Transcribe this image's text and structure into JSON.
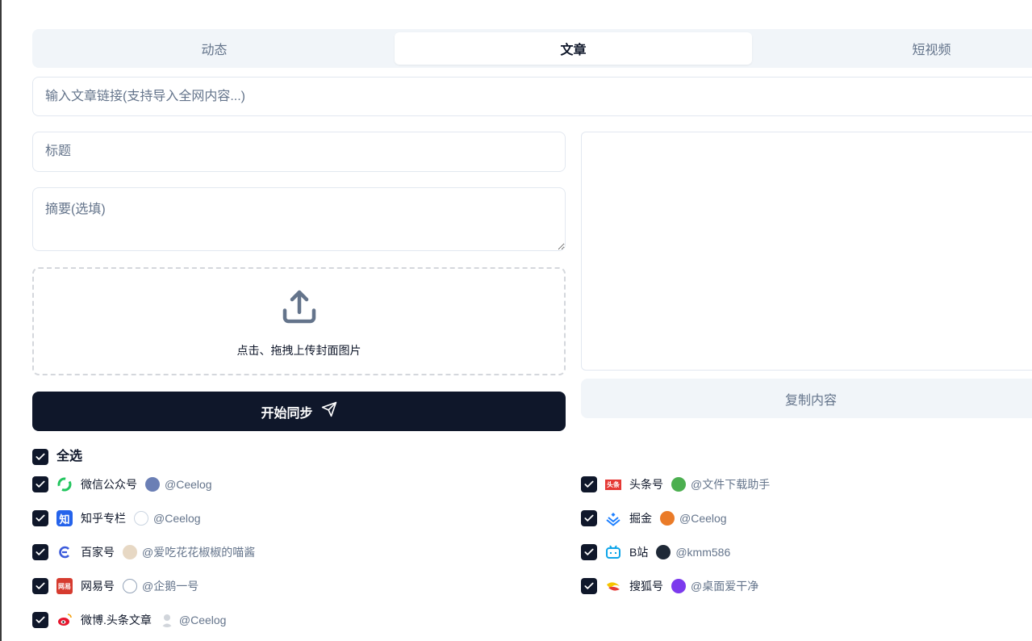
{
  "tabs": [
    {
      "label": "动态",
      "active": false
    },
    {
      "label": "文章",
      "active": true
    },
    {
      "label": "短视频",
      "active": false
    }
  ],
  "link_input": {
    "placeholder": "输入文章链接(支持导入全网内容...)",
    "value": ""
  },
  "title_input": {
    "placeholder": "标题",
    "value": ""
  },
  "summary_input": {
    "placeholder": "摘要(选填)",
    "value": ""
  },
  "upload": {
    "text": "点击、拖拽上传封面图片",
    "icon": "upload-icon"
  },
  "sync_button": {
    "label": "开始同步",
    "icon": "send-icon"
  },
  "copy_button": {
    "label": "复制内容"
  },
  "select_all": {
    "label": "全选",
    "checked": true
  },
  "platforms_left": [
    {
      "name": "微信公众号",
      "account": "@Ceelog",
      "checked": true,
      "icon": "wechat-icon"
    },
    {
      "name": "知乎专栏",
      "account": "@Ceelog",
      "checked": true,
      "icon": "zhihu-icon"
    },
    {
      "name": "百家号",
      "account": "@爱吃花花椒椒的喵酱",
      "checked": true,
      "icon": "baijiahao-icon"
    },
    {
      "name": "网易号",
      "account": "@企鹅一号",
      "checked": true,
      "icon": "netease-icon"
    },
    {
      "name": "微博.头条文章",
      "account": "@Ceelog",
      "checked": true,
      "icon": "weibo-icon"
    }
  ],
  "platforms_right": [
    {
      "name": "头条号",
      "account": "@文件下载助手",
      "checked": true,
      "icon": "toutiao-icon"
    },
    {
      "name": "掘金",
      "account": "@Ceelog",
      "checked": true,
      "icon": "juejin-icon"
    },
    {
      "name": "B站",
      "account": "@kmm586",
      "checked": true,
      "icon": "bilibili-icon"
    },
    {
      "name": "搜狐号",
      "account": "@桌面爱干净",
      "checked": true,
      "icon": "sohu-icon"
    }
  ],
  "logo_text": {
    "zhihu": "知",
    "netease": "网易",
    "toutiao": "头条"
  },
  "colors": {
    "primary": "#0f172a",
    "muted": "#64748b",
    "tab_bg": "#f1f5f9",
    "border": "#e2e8f0"
  }
}
